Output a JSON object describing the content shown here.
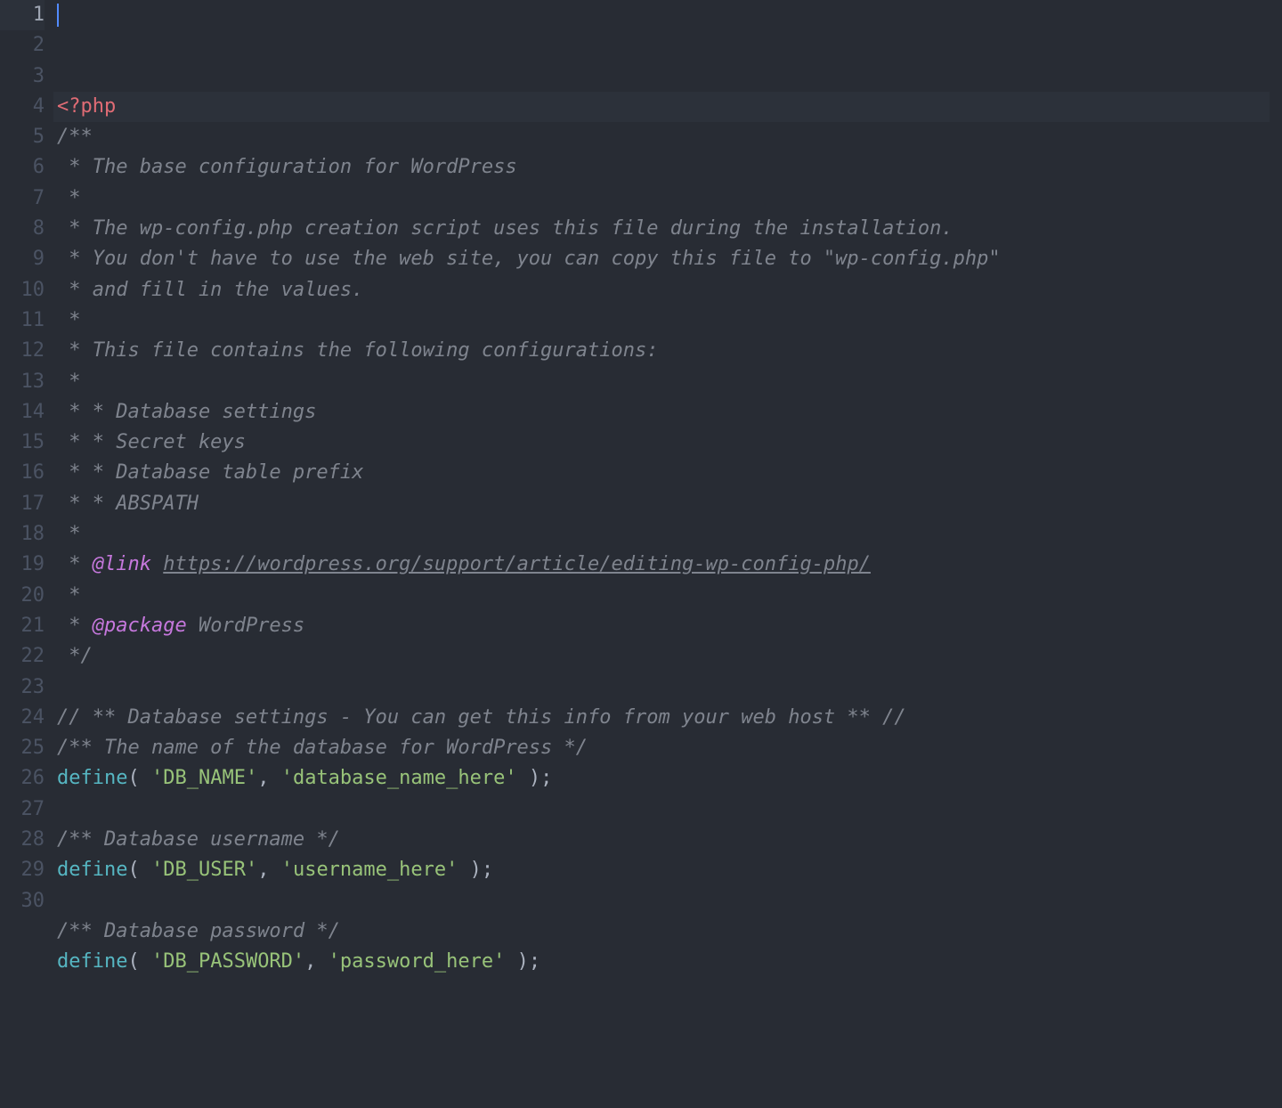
{
  "file": "wp-config.php",
  "language": "php",
  "active_line": 1,
  "lines": [
    {
      "n": 1,
      "tokens": [
        {
          "cls": "tag-open",
          "text": "<?"
        },
        {
          "cls": "tag-name",
          "text": "php"
        }
      ]
    },
    {
      "n": 2,
      "tokens": [
        {
          "cls": "comment",
          "text": "/**"
        }
      ]
    },
    {
      "n": 3,
      "tokens": [
        {
          "cls": "comment",
          "text": " * The base configuration for WordPress"
        }
      ]
    },
    {
      "n": 4,
      "tokens": [
        {
          "cls": "comment",
          "text": " *"
        }
      ]
    },
    {
      "n": 5,
      "tokens": [
        {
          "cls": "comment",
          "text": " * The wp-config.php creation script uses this file during the installation."
        }
      ]
    },
    {
      "n": 6,
      "tokens": [
        {
          "cls": "comment",
          "text": " * You don't have to use the web site, you can copy this file to \"wp-config.php\""
        }
      ]
    },
    {
      "n": 7,
      "tokens": [
        {
          "cls": "comment",
          "text": " * and fill in the values."
        }
      ]
    },
    {
      "n": 8,
      "tokens": [
        {
          "cls": "comment",
          "text": " *"
        }
      ]
    },
    {
      "n": 9,
      "tokens": [
        {
          "cls": "comment",
          "text": " * This file contains the following configurations:"
        }
      ]
    },
    {
      "n": 10,
      "tokens": [
        {
          "cls": "comment",
          "text": " *"
        }
      ]
    },
    {
      "n": 11,
      "tokens": [
        {
          "cls": "comment",
          "text": " * * Database settings"
        }
      ]
    },
    {
      "n": 12,
      "tokens": [
        {
          "cls": "comment",
          "text": " * * Secret keys"
        }
      ]
    },
    {
      "n": 13,
      "tokens": [
        {
          "cls": "comment",
          "text": " * * Database table prefix"
        }
      ]
    },
    {
      "n": 14,
      "tokens": [
        {
          "cls": "comment",
          "text": " * * ABSPATH"
        }
      ]
    },
    {
      "n": 15,
      "tokens": [
        {
          "cls": "comment",
          "text": " *"
        }
      ]
    },
    {
      "n": 16,
      "tokens": [
        {
          "cls": "comment",
          "text": " * "
        },
        {
          "cls": "doc-tag",
          "text": "@link"
        },
        {
          "cls": "comment",
          "text": " "
        },
        {
          "cls": "doc-link",
          "text": "https://wordpress.org/support/article/editing-wp-config-php/"
        }
      ]
    },
    {
      "n": 17,
      "tokens": [
        {
          "cls": "comment",
          "text": " *"
        }
      ]
    },
    {
      "n": 18,
      "tokens": [
        {
          "cls": "comment",
          "text": " * "
        },
        {
          "cls": "doc-tag",
          "text": "@package"
        },
        {
          "cls": "comment",
          "text": " WordPress"
        }
      ]
    },
    {
      "n": 19,
      "tokens": [
        {
          "cls": "comment",
          "text": " */"
        }
      ]
    },
    {
      "n": 20,
      "tokens": [
        {
          "cls": "plain",
          "text": ""
        }
      ]
    },
    {
      "n": 21,
      "tokens": [
        {
          "cls": "comment",
          "text": "// ** Database settings - You can get this info from your web host ** //"
        }
      ]
    },
    {
      "n": 22,
      "tokens": [
        {
          "cls": "comment",
          "text": "/** The name of the database for WordPress */"
        }
      ]
    },
    {
      "n": 23,
      "tokens": [
        {
          "cls": "fn",
          "text": "define"
        },
        {
          "cls": "punct",
          "text": "( "
        },
        {
          "cls": "str",
          "text": "'DB_NAME'"
        },
        {
          "cls": "punct",
          "text": ", "
        },
        {
          "cls": "str",
          "text": "'database_name_here'"
        },
        {
          "cls": "punct",
          "text": " );"
        }
      ]
    },
    {
      "n": 24,
      "tokens": [
        {
          "cls": "plain",
          "text": ""
        }
      ]
    },
    {
      "n": 25,
      "tokens": [
        {
          "cls": "comment",
          "text": "/** Database username */"
        }
      ]
    },
    {
      "n": 26,
      "tokens": [
        {
          "cls": "fn",
          "text": "define"
        },
        {
          "cls": "punct",
          "text": "( "
        },
        {
          "cls": "str",
          "text": "'DB_USER'"
        },
        {
          "cls": "punct",
          "text": ", "
        },
        {
          "cls": "str",
          "text": "'username_here'"
        },
        {
          "cls": "punct",
          "text": " );"
        }
      ]
    },
    {
      "n": 27,
      "tokens": [
        {
          "cls": "plain",
          "text": ""
        }
      ]
    },
    {
      "n": 28,
      "tokens": [
        {
          "cls": "comment",
          "text": "/** Database password */"
        }
      ]
    },
    {
      "n": 29,
      "tokens": [
        {
          "cls": "fn",
          "text": "define"
        },
        {
          "cls": "punct",
          "text": "( "
        },
        {
          "cls": "str",
          "text": "'DB_PASSWORD'"
        },
        {
          "cls": "punct",
          "text": ", "
        },
        {
          "cls": "str",
          "text": "'password_here'"
        },
        {
          "cls": "punct",
          "text": " );"
        }
      ]
    },
    {
      "n": 30,
      "tokens": [
        {
          "cls": "plain",
          "text": ""
        }
      ]
    }
  ]
}
